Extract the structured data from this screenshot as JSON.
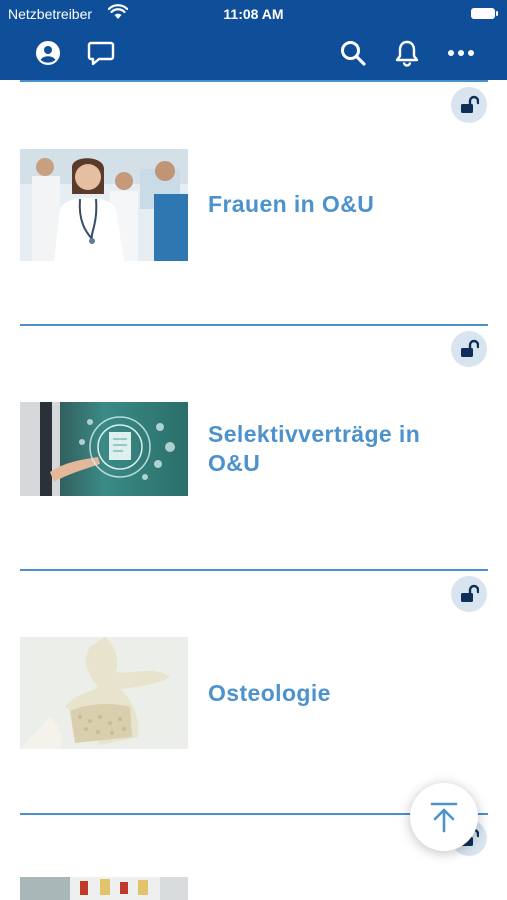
{
  "status_bar": {
    "carrier": "Netzbetreiber",
    "time": "11:08 AM"
  },
  "header": {
    "background": "#0f4f99",
    "icons": [
      "profile-icon",
      "chat-icon",
      "search-icon",
      "bell-icon",
      "more-icon"
    ]
  },
  "items": [
    {
      "title": "Frauen in O&U",
      "locked": false
    },
    {
      "title": "Selektivverträge in O&U",
      "locked": false
    },
    {
      "title": "Osteologie",
      "locked": false
    },
    {
      "title": "",
      "locked": false
    }
  ],
  "fab": {
    "icon": "scroll-to-top-icon"
  },
  "colors": {
    "accent": "#4c92cc",
    "divider": "#4b8fcb",
    "badge": "#d8e4ef"
  }
}
